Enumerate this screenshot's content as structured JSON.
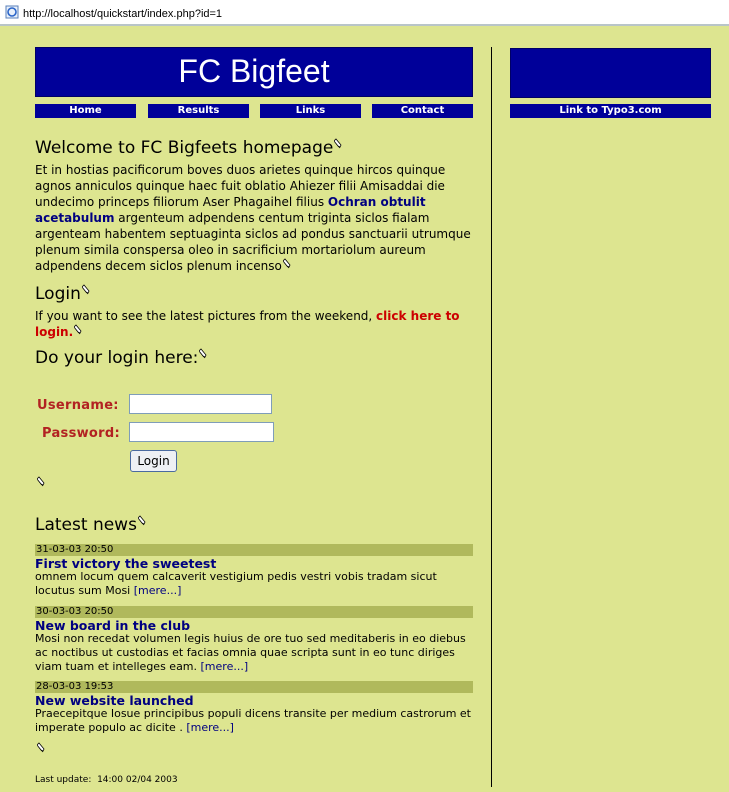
{
  "address_bar": {
    "url": "http://localhost/quickstart/index.php?id=1"
  },
  "site": {
    "title": "FC Bigfeet"
  },
  "nav": [
    "Home",
    "Results",
    "Links",
    "Contact"
  ],
  "right": {
    "link": "Link to Typo3.com"
  },
  "welcome": {
    "heading": "Welcome to FC Bigfeets homepage",
    "text_1": "Et in hostias pacificorum boves duos arietes quinque hircos quinque agnos anniculos quinque haec fuit oblatio Ahiezer filii Amisaddai die undecimo princeps filiorum Aser Phagaihel filius ",
    "link": "Ochran obtulit acetabulum",
    "text_2": " argenteum adpendens centum triginta siclos fialam argenteam habentem septuaginta siclos ad pondus sanctuarii utrumque plenum simila conspersa oleo in sacrificium mortariolum aureum adpendens decem siclos plenum incenso"
  },
  "login": {
    "heading": "Login",
    "text": "If you want to see the latest pictures from the weekend, ",
    "link": "click here to login."
  },
  "login_form": {
    "heading": "Do your login here:",
    "username_label": "Username:",
    "password_label": "Password:",
    "button": "Login"
  },
  "news": {
    "heading": "Latest news",
    "items": [
      {
        "date": "31-03-03 20:50",
        "title": "First victory the sweetest",
        "text": "omnem locum quem calcaverit vestigium pedis vestri vobis tradam sicut locutus sum Mosi ",
        "more": "[mere...]"
      },
      {
        "date": "30-03-03 20:50",
        "title": "New board in the club",
        "text": "Mosi non recedat volumen legis huius de ore tuo sed meditaberis in eo diebus ac noctibus ut custodias et facias omnia quae scripta sunt in eo tunc diriges viam tuam et intelleges eam. ",
        "more": "[mere...]"
      },
      {
        "date": "28-03-03 19:53",
        "title": "New website launched",
        "text": "Praecepitque Iosue principibus populi dicens transite per medium castrorum et imperate populo ac dicite . ",
        "more": "[mere...]"
      }
    ]
  },
  "footer": {
    "last_update": "Last update:  14:00 02/04 2003"
  }
}
